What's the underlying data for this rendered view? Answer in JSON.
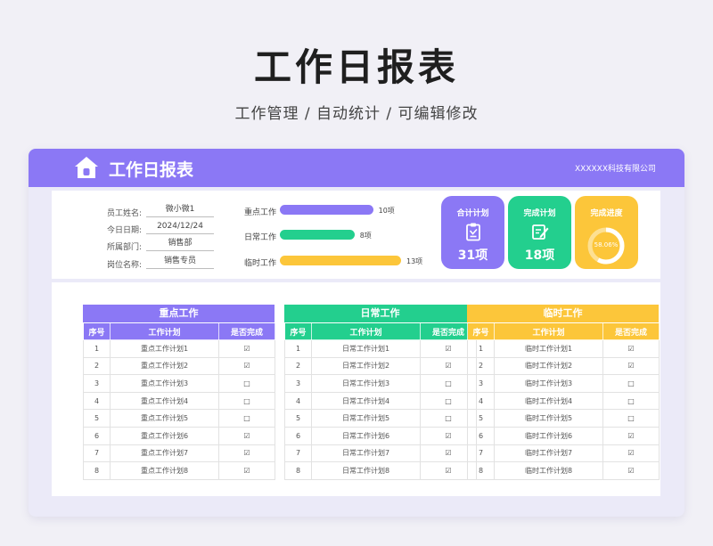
{
  "hero": {
    "title": "工作日报表",
    "subtitle": "工作管理 / 自动统计 / 可编辑修改"
  },
  "header": {
    "title": "工作日报表",
    "company": "XXXXXX科技有限公司",
    "home_icon": "home-icon"
  },
  "info": {
    "fields": [
      {
        "label": "员工姓名:",
        "value": "微小微1"
      },
      {
        "label": "今日日期:",
        "value": "2024/12/24"
      },
      {
        "label": "所属部门:",
        "value": "销售部"
      },
      {
        "label": "岗位名称:",
        "value": "销售专员"
      }
    ]
  },
  "chart_data": {
    "type": "bar",
    "categories": [
      "重点工作",
      "日常工作",
      "临时工作"
    ],
    "values": [
      10,
      8,
      13
    ],
    "value_labels": [
      "10项",
      "8项",
      "13项"
    ],
    "colors": [
      "#8b78f5",
      "#23cf8e",
      "#fcc63a"
    ],
    "orientation": "horizontal"
  },
  "stats": {
    "total": {
      "label": "合计计划",
      "value": "31项",
      "icon": "clipboard-icon",
      "color": "#8b78f5"
    },
    "done": {
      "label": "完成计划",
      "value": "18项",
      "icon": "edit-note-icon",
      "color": "#23cf8e"
    },
    "progress": {
      "label": "完成进度",
      "value": "58.06%",
      "fraction": 0.5806,
      "color": "#fcc63a"
    }
  },
  "tables": [
    {
      "title": "重点工作",
      "color": "#8b78f5",
      "headers": [
        "序号",
        "工作计划",
        "是否完成"
      ],
      "rows": [
        {
          "no": "1",
          "plan": "重点工作计划1",
          "done": "☑"
        },
        {
          "no": "2",
          "plan": "重点工作计划2",
          "done": "☑"
        },
        {
          "no": "3",
          "plan": "重点工作计划3",
          "done": "□"
        },
        {
          "no": "4",
          "plan": "重点工作计划4",
          "done": "□"
        },
        {
          "no": "5",
          "plan": "重点工作计划5",
          "done": "□"
        },
        {
          "no": "6",
          "plan": "重点工作计划6",
          "done": "☑"
        },
        {
          "no": "7",
          "plan": "重点工作计划7",
          "done": "☑"
        },
        {
          "no": "8",
          "plan": "重点工作计划8",
          "done": "☑"
        }
      ]
    },
    {
      "title": "日常工作",
      "color": "#23cf8e",
      "headers": [
        "序号",
        "工作计划",
        "是否完成"
      ],
      "rows": [
        {
          "no": "1",
          "plan": "日常工作计划1",
          "done": "☑"
        },
        {
          "no": "2",
          "plan": "日常工作计划2",
          "done": "☑"
        },
        {
          "no": "3",
          "plan": "日常工作计划3",
          "done": "□"
        },
        {
          "no": "4",
          "plan": "日常工作计划4",
          "done": "□"
        },
        {
          "no": "5",
          "plan": "日常工作计划5",
          "done": "□"
        },
        {
          "no": "6",
          "plan": "日常工作计划6",
          "done": "☑"
        },
        {
          "no": "7",
          "plan": "日常工作计划7",
          "done": "☑"
        },
        {
          "no": "8",
          "plan": "日常工作计划8",
          "done": "☑"
        }
      ]
    },
    {
      "title": "临时工作",
      "color": "#fcc63a",
      "headers": [
        "序号",
        "工作计划",
        "是否完成"
      ],
      "rows": [
        {
          "no": "1",
          "plan": "临时工作计划1",
          "done": "☑"
        },
        {
          "no": "2",
          "plan": "临时工作计划2",
          "done": "☑"
        },
        {
          "no": "3",
          "plan": "临时工作计划3",
          "done": "□"
        },
        {
          "no": "4",
          "plan": "临时工作计划4",
          "done": "□"
        },
        {
          "no": "5",
          "plan": "临时工作计划5",
          "done": "□"
        },
        {
          "no": "6",
          "plan": "临时工作计划6",
          "done": "☑"
        },
        {
          "no": "7",
          "plan": "临时工作计划7",
          "done": "☑"
        },
        {
          "no": "8",
          "plan": "临时工作计划8",
          "done": "☑"
        }
      ]
    }
  ]
}
